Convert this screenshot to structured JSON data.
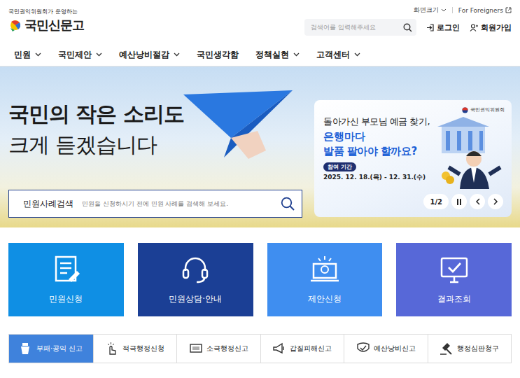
{
  "header": {
    "tagline": "국민권익위원회가 운영하는",
    "logo": "국민신문고",
    "util_links": [
      {
        "label": "화면크기",
        "kind": "menu"
      },
      {
        "label": "For Foreigners",
        "kind": "external"
      }
    ],
    "search": {
      "placeholder": "검색어를 입력해주세요"
    },
    "auth": [
      {
        "label": "로그인",
        "kind": "login"
      },
      {
        "label": "회원가입",
        "kind": "join"
      }
    ]
  },
  "nav": [
    {
      "label": "민원",
      "expandable": true
    },
    {
      "label": "국민제안",
      "expandable": true
    },
    {
      "label": "예산낭비절감",
      "expandable": true
    },
    {
      "label": "국민생각함",
      "expandable": false
    },
    {
      "label": "정책실현",
      "expandable": true
    },
    {
      "label": "고객센터",
      "expandable": true
    }
  ],
  "hero": {
    "title_lines": [
      "국민의 작은 소리도",
      "크게 듣겠습니다"
    ],
    "case_search": {
      "label": "민원사례검색",
      "placeholder": "민원을 신청하시기 전에 민원 사례를 검색해 보세요."
    }
  },
  "banner": {
    "org": "국민권익위원회",
    "line1": "돌아가신 부모님 예금 찾기,",
    "highlight": "은행마다",
    "line3": "발품 팔아야 할까요?",
    "period_label": "참여 기간",
    "period": "2025. 12. 18.(목) - 12. 31.(수)",
    "counter": "1/2"
  },
  "tiles": [
    {
      "label": "민원신청",
      "color": "#0f8fe4",
      "kind": "document"
    },
    {
      "label": "민원상담·안내",
      "color": "#1b3f95",
      "kind": "headset"
    },
    {
      "label": "제안신청",
      "color": "#3f8ef0",
      "kind": "idea"
    },
    {
      "label": "결과조회",
      "color": "#5768d8",
      "kind": "monitor"
    }
  ],
  "report_tabs": [
    {
      "label": "부패·공익 신고",
      "selected": true
    },
    {
      "label": "적극행정신청",
      "selected": false
    },
    {
      "label": "소극행정신고",
      "selected": false
    },
    {
      "label": "갑질피해신고",
      "selected": false
    },
    {
      "label": "예산낭비신고",
      "selected": false
    },
    {
      "label": "행정심판청구",
      "selected": false
    }
  ]
}
